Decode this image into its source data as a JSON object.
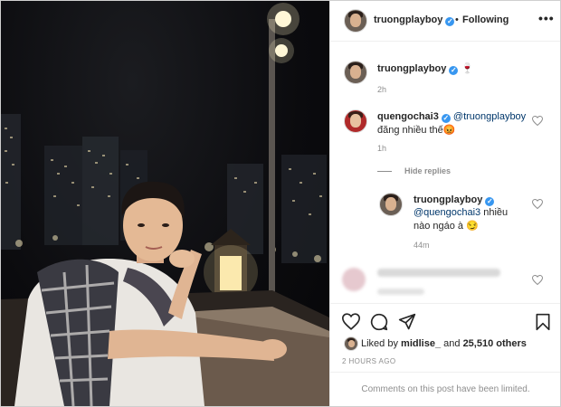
{
  "post": {
    "author": "truongplayboy",
    "separator": "•",
    "follow_status": "Following",
    "more_glyph": "•••",
    "caption_emoji": "🍷",
    "caption_time": "2h"
  },
  "comments": [
    {
      "user": "quengochai3",
      "mention": "@truongplayboy",
      "text": "đăng nhiều thế😡",
      "time": "1h"
    }
  ],
  "hide_replies_label": "Hide replies",
  "reply": {
    "user": "truongplayboy",
    "mention": "@quengochai3",
    "text_1": "nhiều",
    "text_2": "nào ngáo à 😏",
    "time": "44m"
  },
  "likes": {
    "prefix": "Liked by",
    "user": "midlise_",
    "conjunction": "and",
    "count_text": "25,510 others"
  },
  "timestamp": "2 HOURS AGO",
  "comments_limited": "Comments on this post have been limited.",
  "colors": {
    "verified": "#3897f0",
    "mention": "#00376b",
    "muted": "#8e8e8e"
  },
  "icons": [
    "heart-icon",
    "comment-icon",
    "share-icon",
    "bookmark-icon",
    "verified-badge-icon",
    "more-options-icon"
  ]
}
